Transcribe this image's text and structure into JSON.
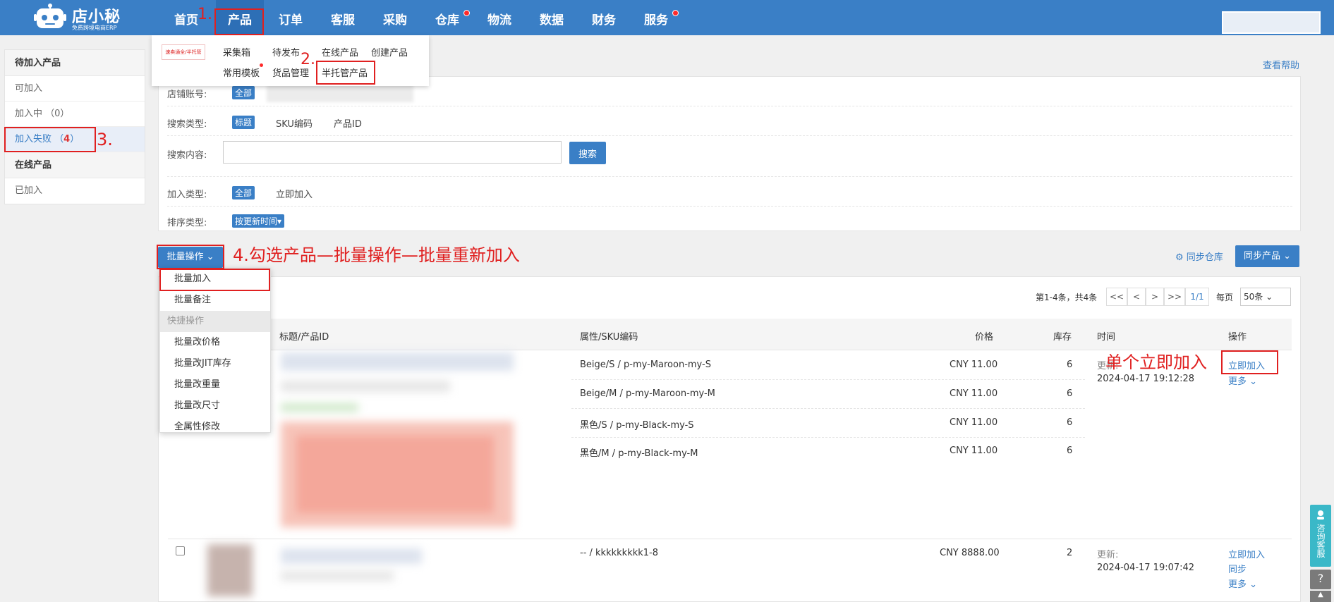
{
  "header": {
    "brand": "店小秘",
    "slogan": "免费跨境电商ERP",
    "nav": [
      {
        "label": "首页"
      },
      {
        "label": "产品"
      },
      {
        "label": "订单"
      },
      {
        "label": "客服"
      },
      {
        "label": "采购"
      },
      {
        "label": "仓库"
      },
      {
        "label": "物流"
      },
      {
        "label": "数据"
      },
      {
        "label": "财务"
      },
      {
        "label": "服务"
      }
    ]
  },
  "product_menu": {
    "badge": "速卖通全/半托管",
    "links": [
      "采集箱",
      "待发布",
      "在线产品",
      "创建产品",
      "常用模板",
      "货品管理",
      "半托管产品"
    ]
  },
  "sidebar": {
    "group1_title": "待加入产品",
    "items": [
      {
        "label": "可加入"
      },
      {
        "label": "加入中",
        "count": "（0）"
      },
      {
        "label": "加入失败",
        "count_open": "（",
        "count": "4",
        "count_close": "）"
      }
    ],
    "group2_title": "在线产品",
    "items2": [
      {
        "label": "已加入"
      }
    ]
  },
  "help_link": "查看帮助",
  "filters": {
    "shop_label": "店铺账号:",
    "shop_all": "全部",
    "search_type_label": "搜索类型:",
    "search_types": [
      "标题",
      "SKU编码",
      "产品ID"
    ],
    "search_content_label": "搜索内容:",
    "search_input_value": "",
    "search_button": "搜索",
    "join_type_label": "加入类型:",
    "join_all": "全部",
    "join_now": "立即加入",
    "sort_label": "排序类型:",
    "sort_value": "按更新时间▾"
  },
  "toolbar": {
    "batch_label": "批量操作 ⌄",
    "sync_warehouse": "⚙ 同步仓库",
    "sync_product": "同步产品 ⌄"
  },
  "batch_menu": {
    "items": [
      "批量加入",
      "批量备注"
    ],
    "group": "快捷操作",
    "quick_items": [
      "批量改价格",
      "批量改JIT库存",
      "批量改重量",
      "批量改尺寸",
      "全属性修改"
    ]
  },
  "pager": {
    "summary": "第1-4条，共4条",
    "first": "<<",
    "prev": "<",
    "next": ">",
    "last": ">>",
    "page": "1/1",
    "per_page_label": "每页",
    "per_page_value": "50条 ⌄"
  },
  "table": {
    "headers": {
      "title": "标题/产品ID",
      "sku": "属性/SKU编码",
      "price": "价格",
      "stock": "库存",
      "time": "时间",
      "action": "操作"
    },
    "rows": [
      {
        "variants": [
          {
            "sku": "Beige/S  /  p-my-Maroon-my-S",
            "price": "CNY 11.00",
            "stock": "6"
          },
          {
            "sku": "Beige/M  /  p-my-Maroon-my-M",
            "price": "CNY 11.00",
            "stock": "6"
          },
          {
            "sku": "黑色/S  /  p-my-Black-my-S",
            "price": "CNY 11.00",
            "stock": "6"
          },
          {
            "sku": "黑色/M  /  p-my-Black-my-M",
            "price": "CNY 11.00",
            "stock": "6"
          }
        ],
        "time_label": "更新:",
        "time": "2024-04-17 19:12:28",
        "actions": [
          "立即加入",
          "更多 ⌄"
        ]
      },
      {
        "variants": [
          {
            "sku": "--  /  kkkkkkkkk1-8",
            "price": "CNY 8888.00",
            "stock": "2"
          }
        ],
        "time_label": "更新:",
        "time": "2024-04-17 19:07:42",
        "actions": [
          "立即加入",
          "同步",
          "更多 ⌄"
        ]
      }
    ]
  },
  "annotations": {
    "step1": "1.",
    "step2": "2.",
    "step3": "3.",
    "step4": "4.勾选产品—批量操作—批量重新加入",
    "single": "单个立即加入"
  },
  "float": {
    "cs": "咨询客服",
    "help": "?",
    "up": "▲"
  },
  "colors": {
    "primary": "#3a7fc6",
    "annotation": "#e02020",
    "badge_dot": "#ff2a2a",
    "float_cs": "#3ab8c8"
  }
}
